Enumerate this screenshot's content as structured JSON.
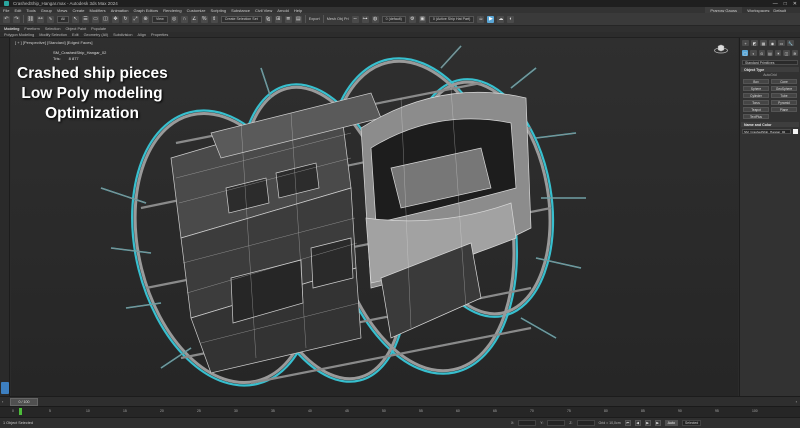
{
  "window": {
    "title": "CrashedShip_Hangar.max - Autodesk 3ds Max 2024",
    "controls": [
      "—",
      "□",
      "✕"
    ]
  },
  "menu": {
    "items": [
      "File",
      "Edit",
      "Tools",
      "Group",
      "Views",
      "Create",
      "Modifiers",
      "Animation",
      "Graph Editors",
      "Rendering",
      "Customize",
      "Scripting",
      "Substance",
      "Civil View",
      "Arnold",
      "Help"
    ],
    "user": "Prarrow Gauss",
    "workspace_label": "Workspaces:",
    "workspace_value": "Default"
  },
  "toolbar": {
    "filter": "All",
    "selection_set": "Create Selection Set",
    "view": "View",
    "export": "Export",
    "mesh": "Mesh Obj Pri",
    "layer": "0 (default)",
    "render_preset": "0 (Active Ship Hat Part)"
  },
  "ribbon": {
    "tabs": [
      "Modeling",
      "Freeform",
      "Selection",
      "Object Paint",
      "Populate"
    ],
    "subtabs": [
      "Polygon Modeling",
      "Modify Selection",
      "Edit",
      "Geometry (All)",
      "Subdivision",
      "Align",
      "Properties"
    ]
  },
  "viewport": {
    "label": "[ + ] [Perspective] [Standard] [Edged Faces]",
    "object_name": "SM_CrashedShip_Hangar_02",
    "polys_label": "Tris:",
    "polys_value": "8 877",
    "overlay": {
      "line1": "Crashed ship pieces",
      "line2": "Low Poly modeling",
      "line3": "Optimization"
    }
  },
  "command_panel": {
    "tab_icons": [
      "+",
      "◩",
      "▦",
      "◉",
      "▭",
      "🔧"
    ],
    "create_icons": [
      "◯",
      "◐",
      "⊙",
      "▤",
      "☀",
      "◫",
      "≋"
    ],
    "category": "Standard Primitives",
    "object_type_title": "Object Type",
    "autogrid": "AutoGrid",
    "primitives": [
      "Box",
      "Cone",
      "Sphere",
      "GeoSphere",
      "Cylinder",
      "Tube",
      "Torus",
      "Pyramid",
      "Teapot",
      "Plane",
      "TextPlus"
    ],
    "name_color_title": "Name and Color",
    "name_value": "SM_CrashedShip_Hangar_02"
  },
  "timeline": {
    "slider_label": "0 / 100",
    "ticks": [
      "0",
      "5",
      "10",
      "15",
      "20",
      "25",
      "30",
      "35",
      "40",
      "45",
      "50",
      "55",
      "60",
      "65",
      "70",
      "75",
      "80",
      "85",
      "90",
      "95",
      "100"
    ]
  },
  "status": {
    "selection": "1 Object Selected",
    "x_label": "X:",
    "x_value": "",
    "y_label": "Y:",
    "y_value": "",
    "z_label": "Z:",
    "z_value": "",
    "grid": "Grid = 10,0cm",
    "addtime": "Add Time Tag",
    "auto": "Auto",
    "selected": "Selected",
    "setkey": "Set K.",
    "filters": "Filters...",
    "frame": "0"
  },
  "colors": {
    "accent": "#5aa6d6",
    "wire": "#38c8d8",
    "mesh_dark": "#3b3b3b",
    "mesh_light": "#8c8c8c"
  }
}
